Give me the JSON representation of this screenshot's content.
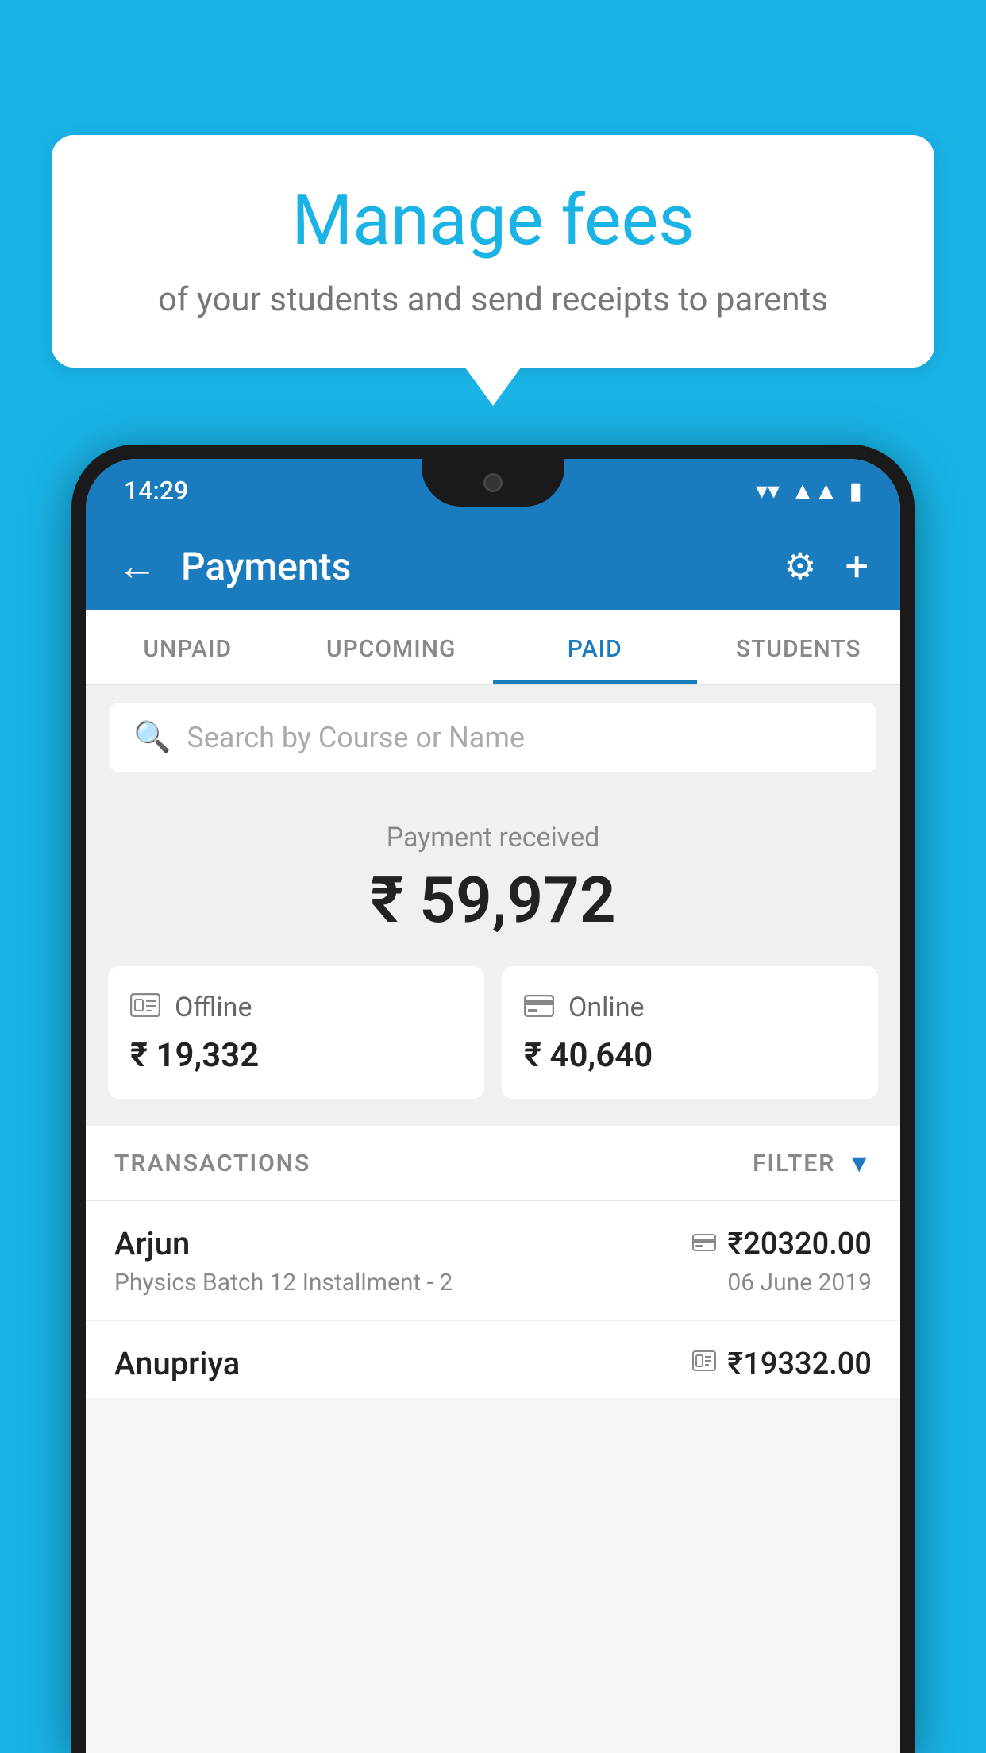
{
  "background_color": "#19b3e6",
  "bubble": {
    "title": "Manage fees",
    "subtitle": "of your students and send receipts to parents"
  },
  "phone": {
    "status_bar": {
      "time": "14:29"
    },
    "header": {
      "title": "Payments",
      "back_label": "←",
      "gear_label": "⚙",
      "plus_label": "+"
    },
    "tabs": [
      {
        "id": "unpaid",
        "label": "UNPAID",
        "active": false
      },
      {
        "id": "upcoming",
        "label": "UPCOMING",
        "active": false
      },
      {
        "id": "paid",
        "label": "PAID",
        "active": true
      },
      {
        "id": "students",
        "label": "STUDENTS",
        "active": false
      }
    ],
    "search": {
      "placeholder": "Search by Course or Name"
    },
    "payment_received": {
      "label": "Payment received",
      "amount": "₹ 59,972"
    },
    "cards": [
      {
        "id": "offline",
        "icon": "💳",
        "label": "Offline",
        "amount": "₹ 19,332"
      },
      {
        "id": "online",
        "icon": "💳",
        "label": "Online",
        "amount": "₹ 40,640"
      }
    ],
    "transactions": {
      "header_label": "TRANSACTIONS",
      "filter_label": "FILTER"
    },
    "transaction_list": [
      {
        "name": "Arjun",
        "amount": "₹20320.00",
        "detail": "Physics Batch 12 Installment - 2",
        "date": "06 June 2019",
        "type_icon": "card"
      },
      {
        "name": "Anupriya",
        "amount": "₹19332.00",
        "type_icon": "cash"
      }
    ]
  }
}
